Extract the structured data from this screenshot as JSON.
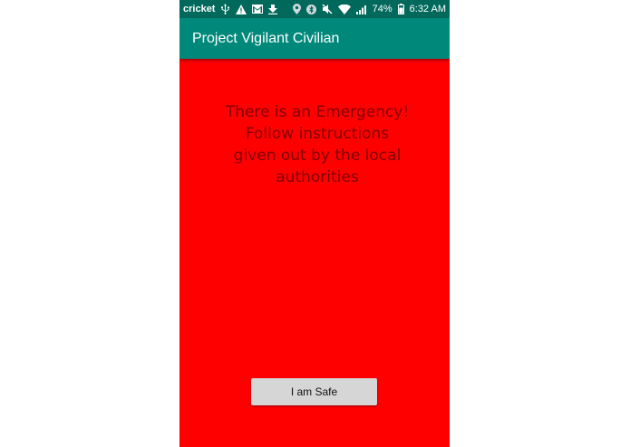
{
  "status_bar": {
    "carrier": "cricket",
    "battery_percent": "74%",
    "time": "6:32 AM",
    "left_icons": [
      "usb-icon",
      "warning-icon",
      "gmail-icon",
      "download-icon"
    ],
    "right_icons": [
      "location-icon",
      "bluetooth-icon",
      "mute-icon",
      "wifi-icon",
      "signal-icon",
      "battery-icon"
    ]
  },
  "app_bar": {
    "title": "Project Vigilant Civilian"
  },
  "main": {
    "message_lines": [
      "There is an Emergency!",
      "Follow instructions",
      "given out by the local",
      "authorities"
    ],
    "safe_button_label": "I am Safe"
  },
  "colors": {
    "status_bar": "#00695c",
    "app_bar": "#00897b",
    "background": "#ff0000",
    "message_text": "#7f0000",
    "button": "#d6d6d6"
  }
}
